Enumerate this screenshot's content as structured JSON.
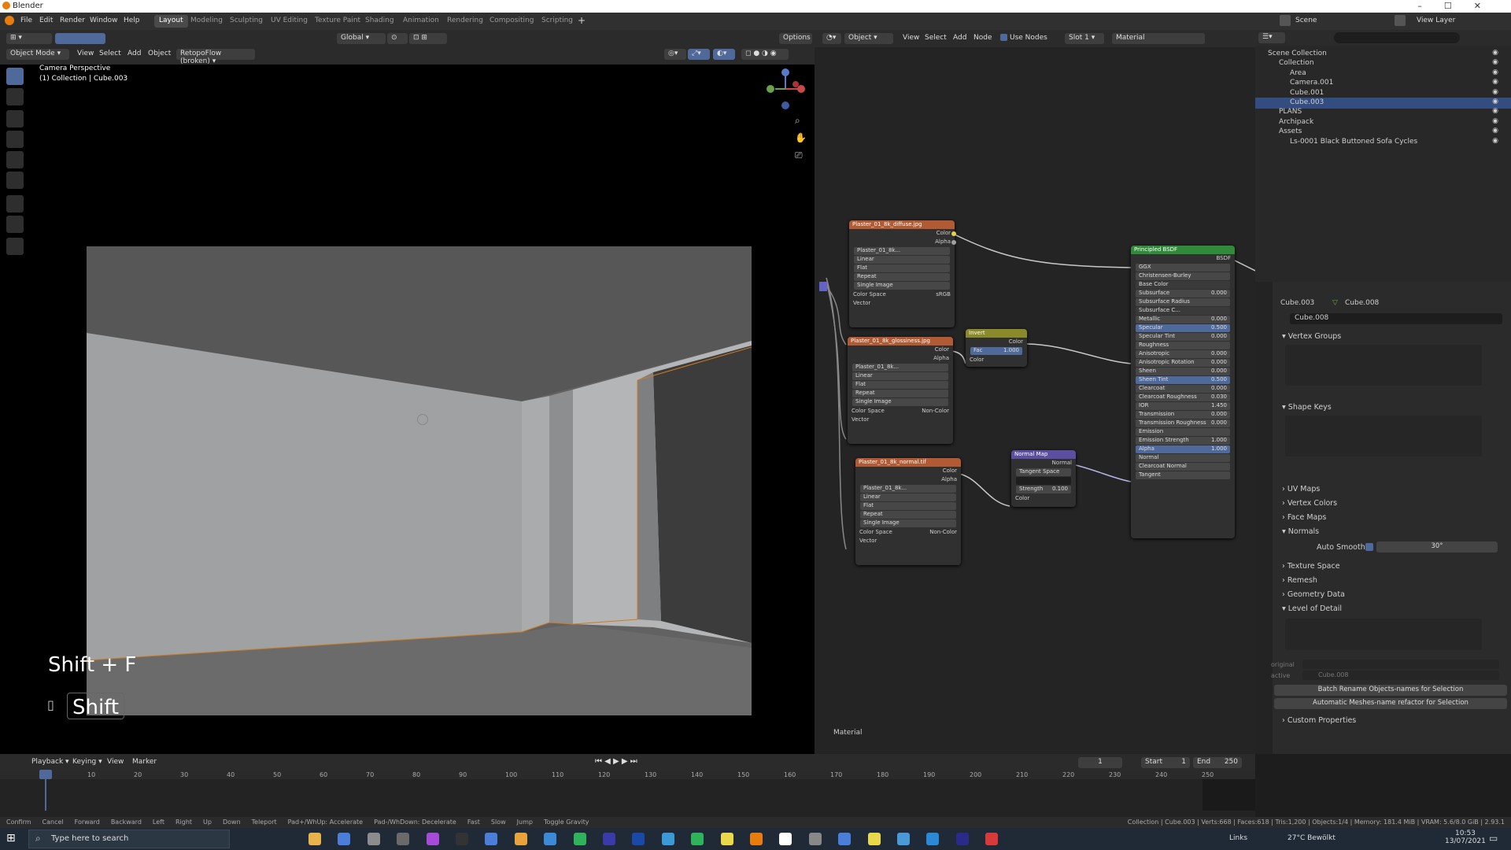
{
  "window": {
    "title": "Blender"
  },
  "menubar": {
    "menus": [
      "File",
      "Edit",
      "Render",
      "Window",
      "Help"
    ],
    "workspaces": [
      "Layout",
      "Modeling",
      "Sculpting",
      "UV Editing",
      "Texture Paint",
      "Shading",
      "Animation",
      "Rendering",
      "Compositing",
      "Scripting"
    ],
    "active_workspace": "Layout",
    "scene": "Scene",
    "view_layer": "View Layer"
  },
  "viewport": {
    "mode": "Object Mode",
    "menus": [
      "View",
      "Select",
      "Add",
      "Object"
    ],
    "addon_menu": "RetopoFlow (broken)",
    "transform_orientation": "Global",
    "options": "Options",
    "overlay_title": "Camera Perspective",
    "overlay_subtitle": "(1) Collection | Cube.003",
    "shortcut": "Shift + F",
    "key_badge": "Shift"
  },
  "node_editor": {
    "object_menu": "Object",
    "menus": [
      "View",
      "Select",
      "Add",
      "Node"
    ],
    "use_nodes_label": "Use Nodes",
    "slot": "Slot 1",
    "material": "Material",
    "footer_label": "Material",
    "nodes": {
      "diffuse": {
        "title": "Plaster_01_8k_diffuse.jpg",
        "image": "Plaster_01_8k...",
        "outputs": [
          "Color",
          "Alpha"
        ],
        "fields": [
          "Linear",
          "Flat",
          "Repeat",
          "Single Image"
        ],
        "color_space_label": "Color Space",
        "color_space": "sRGB",
        "vector": "Vector"
      },
      "gloss": {
        "title": "Plaster_01_8k_glossiness.jpg",
        "image": "Plaster_01_8k...",
        "outputs": [
          "Color",
          "Alpha"
        ],
        "fields": [
          "Linear",
          "Flat",
          "Repeat",
          "Single Image"
        ],
        "color_space_label": "Color Space",
        "color_space": "Non-Color",
        "vector": "Vector"
      },
      "normal_tex": {
        "title": "Plaster_01_8k_normal.tif",
        "image": "Plaster_01_8k...",
        "outputs": [
          "Color",
          "Alpha"
        ],
        "fields": [
          "Linear",
          "Flat",
          "Repeat",
          "Single Image"
        ],
        "color_space_label": "Color Space",
        "color_space": "Non-Color",
        "vector": "Vector"
      },
      "invert": {
        "title": "Invert",
        "output": "Color",
        "fac_label": "Fac",
        "fac_value": "1.000",
        "input": "Color"
      },
      "normal_map": {
        "title": "Normal Map",
        "output": "Normal",
        "space": "Tangent Space",
        "strength_label": "Strength",
        "strength_value": "0.100",
        "input": "Color"
      },
      "bsdf": {
        "title": "Principled BSDF",
        "output": "BSDF",
        "distribution": "GGX",
        "subsurface_method": "Christensen-Burley",
        "rows": [
          {
            "label": "Base Color",
            "value": ""
          },
          {
            "label": "Subsurface",
            "value": "0.000"
          },
          {
            "label": "Subsurface Radius",
            "value": ""
          },
          {
            "label": "Subsurface C...",
            "value": ""
          },
          {
            "label": "Metallic",
            "value": "0.000"
          },
          {
            "label": "Specular",
            "value": "0.500"
          },
          {
            "label": "Specular Tint",
            "value": "0.000"
          },
          {
            "label": "Roughness",
            "value": ""
          },
          {
            "label": "Anisotropic",
            "value": "0.000"
          },
          {
            "label": "Anisotropic Rotation",
            "value": "0.000"
          },
          {
            "label": "Sheen",
            "value": "0.000"
          },
          {
            "label": "Sheen Tint",
            "value": "0.500"
          },
          {
            "label": "Clearcoat",
            "value": "0.000"
          },
          {
            "label": "Clearcoat Roughness",
            "value": "0.030"
          },
          {
            "label": "IOR",
            "value": "1.450"
          },
          {
            "label": "Transmission",
            "value": "0.000"
          },
          {
            "label": "Transmission Roughness",
            "value": "0.000"
          },
          {
            "label": "Emission",
            "value": ""
          },
          {
            "label": "Emission Strength",
            "value": "1.000"
          },
          {
            "label": "Alpha",
            "value": "1.000"
          },
          {
            "label": "Normal",
            "value": ""
          },
          {
            "label": "Clearcoat Normal",
            "value": ""
          },
          {
            "label": "Tangent",
            "value": ""
          }
        ]
      }
    }
  },
  "outliner": {
    "rows": [
      {
        "name": "Scene Collection",
        "indent": 0,
        "selected": false
      },
      {
        "name": "Collection",
        "indent": 1,
        "selected": false
      },
      {
        "name": "Area",
        "indent": 2,
        "selected": false
      },
      {
        "name": "Camera.001",
        "indent": 2,
        "selected": false
      },
      {
        "name": "Cube.001",
        "indent": 2,
        "selected": false
      },
      {
        "name": "Cube.003",
        "indent": 2,
        "selected": true
      },
      {
        "name": "PLANS",
        "indent": 1,
        "selected": false
      },
      {
        "name": "Archipack",
        "indent": 1,
        "selected": false
      },
      {
        "name": "Assets",
        "indent": 1,
        "selected": false
      },
      {
        "name": "Ls-0001 Black Buttoned Sofa Cycles",
        "indent": 2,
        "selected": false
      }
    ]
  },
  "properties": {
    "object": "Cube.003",
    "mesh": "Cube.008",
    "mesh_field": "Cube.008",
    "sections": [
      "Vertex Groups",
      "Shape Keys",
      "UV Maps",
      "Vertex Colors",
      "Face Maps",
      "Normals"
    ],
    "auto_smooth_label": "Auto Smooth",
    "auto_smooth_angle": "30°",
    "sections2": [
      "Texture Space",
      "Remesh",
      "Geometry Data",
      "Level of Detail"
    ],
    "lod_original_label": "original",
    "lod_active_label": "active",
    "lod_active_value": "Cube.008",
    "button1": "Batch Rename Objects-names for Selection",
    "button2": "Automatic Meshes-name refactor for Selection",
    "custom_props": "Custom Properties"
  },
  "timeline": {
    "menus": [
      "Playback",
      "Keying",
      "View",
      "Marker"
    ],
    "current_frame": "1",
    "start_label": "Start",
    "start": "1",
    "end_label": "End",
    "end": "250",
    "ticks": [
      "0",
      "10",
      "20",
      "30",
      "40",
      "50",
      "60",
      "70",
      "80",
      "90",
      "100",
      "110",
      "120",
      "130",
      "140",
      "150",
      "160",
      "170",
      "180",
      "190",
      "200",
      "210",
      "220",
      "230",
      "240",
      "250"
    ]
  },
  "statusbar": {
    "hints": [
      "Confirm",
      "Cancel",
      "Forward",
      "Backward",
      "Left",
      "Right",
      "Up",
      "Down",
      "Teleport",
      "Pad+/WhUp: Accelerate",
      "Pad-/WhDown: Decelerate",
      "Fast",
      "Slow",
      "Jump",
      "Toggle Gravity"
    ],
    "stats": "Collection | Cube.003 | Verts:668 | Faces:618 | Tris:1,200 | Objects:1/4 | Memory: 181.4 MiB | VRAM: 5.6/8.0 GiB | 2.93.1"
  },
  "taskbar": {
    "search_placeholder": "Type here to search",
    "links": "Links",
    "weather": "27°C  Bewölkt",
    "time": "10:53",
    "date": "13/07/2021"
  }
}
